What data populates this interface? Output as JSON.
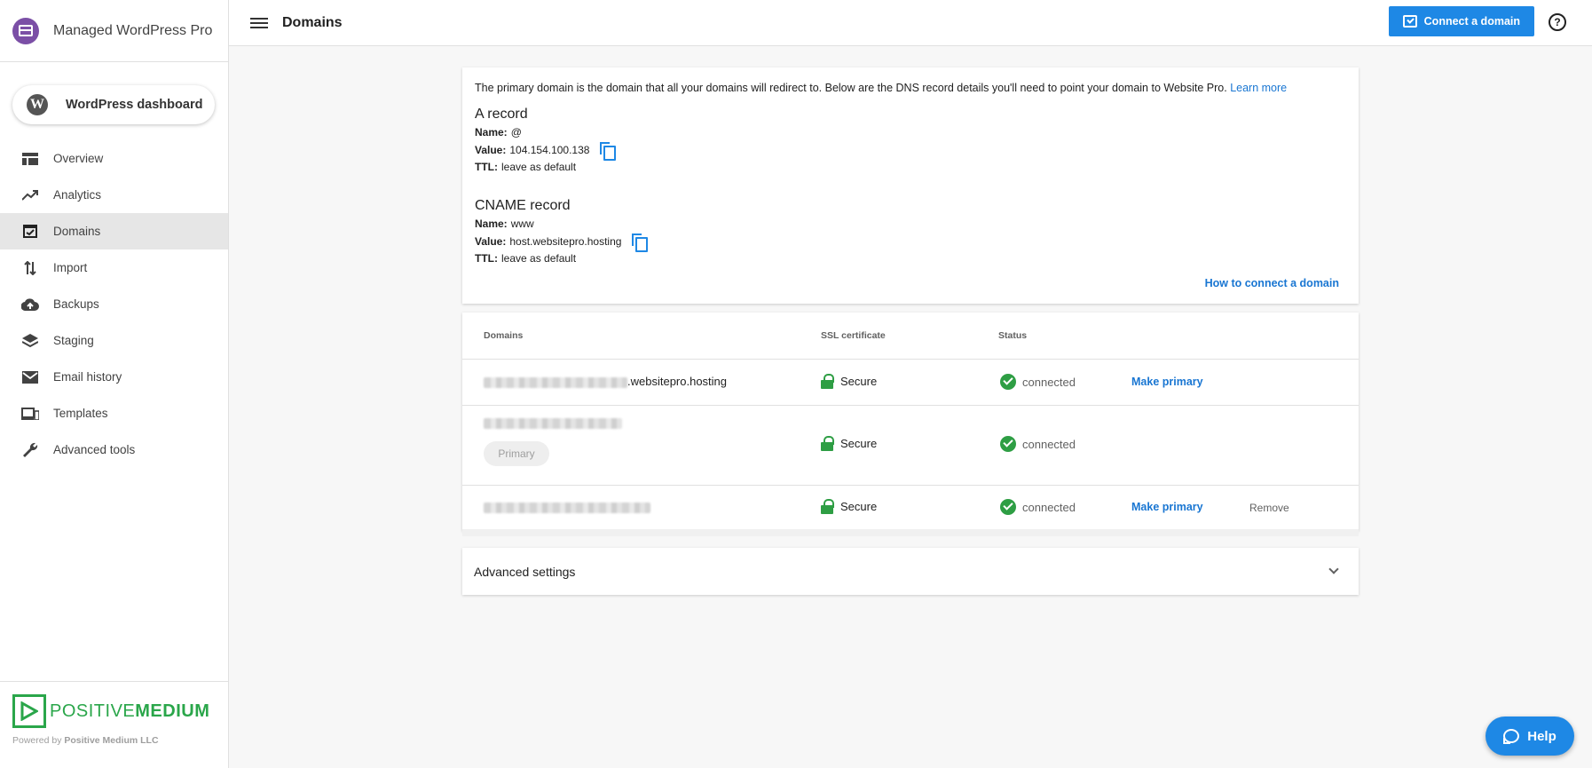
{
  "app": {
    "title": "Managed WordPress Pro"
  },
  "sidebar": {
    "wp_dashboard_label": "WordPress dashboard",
    "items": [
      {
        "label": "Overview",
        "icon": "overview-icon"
      },
      {
        "label": "Analytics",
        "icon": "analytics-icon"
      },
      {
        "label": "Domains",
        "icon": "domains-icon",
        "active": true
      },
      {
        "label": "Import",
        "icon": "import-icon"
      },
      {
        "label": "Backups",
        "icon": "backups-icon"
      },
      {
        "label": "Staging",
        "icon": "staging-icon"
      },
      {
        "label": "Email history",
        "icon": "email-icon"
      },
      {
        "label": "Templates",
        "icon": "templates-icon"
      },
      {
        "label": "Advanced tools",
        "icon": "wrench-icon"
      }
    ],
    "footer": {
      "logo_text_1": "POSITIVE",
      "logo_text_2": "MEDIUM",
      "powered_prefix": "Powered by",
      "powered_company": "Positive Medium LLC"
    }
  },
  "header": {
    "title": "Domains",
    "connect_button": "Connect a domain",
    "help_symbol": "?"
  },
  "dns": {
    "intro": "The primary domain is the domain that all your domains will redirect to. Below are the DNS record details you'll need to point your domain to Website Pro.",
    "learn_more": "Learn more",
    "a_record": {
      "title": "A record",
      "name_label": "Name:",
      "name_value": "@",
      "value_label": "Value:",
      "value_value": "104.154.100.138",
      "ttl_label": "TTL:",
      "ttl_value": "leave as default"
    },
    "cname_record": {
      "title": "CNAME record",
      "name_label": "Name:",
      "name_value": "www",
      "value_label": "Value:",
      "value_value": "host.websitepro.hosting",
      "ttl_label": "TTL:",
      "ttl_value": "leave as default"
    },
    "how_to": "How to connect a domain"
  },
  "domains_table": {
    "headers": {
      "domains": "Domains",
      "ssl": "SSL certificate",
      "status": "Status"
    },
    "rows": [
      {
        "domain_suffix": ".websitepro.hosting",
        "ssl": "Secure",
        "status": "connected",
        "action": "Make primary"
      },
      {
        "domain_suffix": "",
        "ssl": "Secure",
        "status": "connected",
        "badge": "Primary"
      },
      {
        "domain_suffix": "",
        "ssl": "Secure",
        "status": "connected",
        "action": "Make primary",
        "remove": "Remove"
      }
    ]
  },
  "advanced": {
    "label": "Advanced settings"
  },
  "help_fab": {
    "label": "Help"
  },
  "colors": {
    "primary": "#1e88e5",
    "brand_purple": "#7b4fa6",
    "success": "#2e9e44",
    "logo_green": "#2aa64a"
  }
}
